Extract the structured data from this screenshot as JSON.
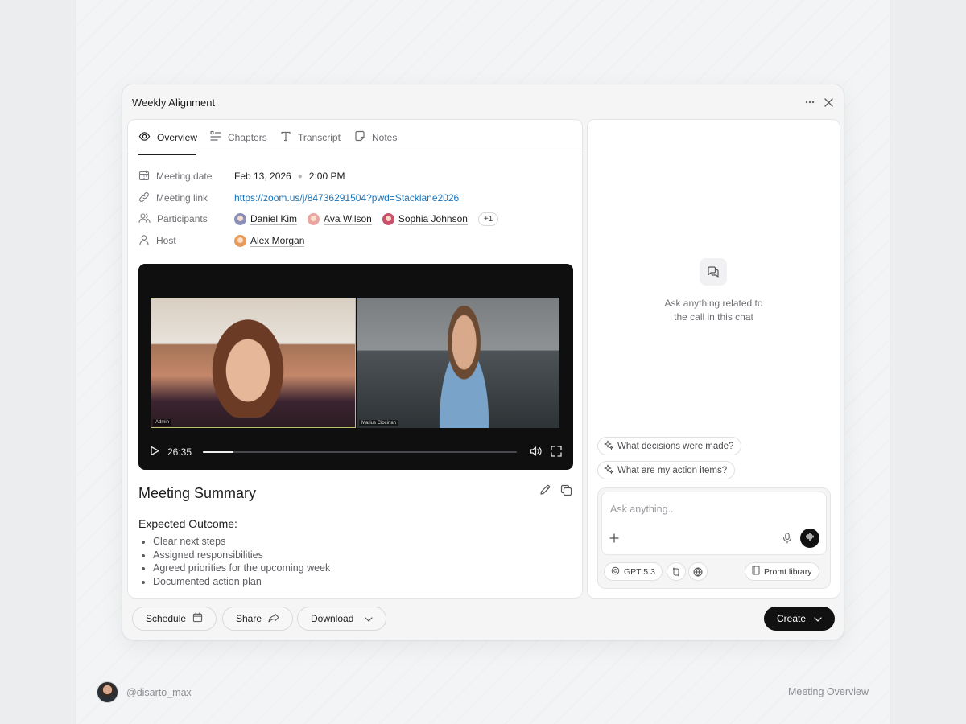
{
  "modal": {
    "title": "Weekly Alignment"
  },
  "tabs": [
    {
      "label": "Overview",
      "icon": "eye-icon",
      "active": true
    },
    {
      "label": "Chapters",
      "icon": "list-icon",
      "active": false
    },
    {
      "label": "Transcript",
      "icon": "text-icon",
      "active": false
    },
    {
      "label": "Notes",
      "icon": "note-icon",
      "active": false
    }
  ],
  "meta": {
    "date_label": "Meeting date",
    "date": "Feb 13, 2026",
    "time": "2:00 PM",
    "link_label": "Meeting link",
    "link": "https://zoom.us/j/84736291504?pwd=Stacklane2026",
    "participants_label": "Participants",
    "participants": [
      {
        "name": "Daniel Kim",
        "color": "#8a8fb8"
      },
      {
        "name": "Ava Wilson",
        "color": "#e9a6a0"
      },
      {
        "name": "Sophia Johnson",
        "color": "#c9506a"
      }
    ],
    "participants_more": "+1",
    "host_label": "Host",
    "host": {
      "name": "Alex Morgan",
      "color": "#e79a5a"
    }
  },
  "video": {
    "tiles": [
      {
        "label": "Admin"
      },
      {
        "label": "Marius Ciocirlan"
      }
    ],
    "time": "26:35",
    "progress": 0.097
  },
  "summary": {
    "title": "Meeting Summary",
    "section_title": "Expected Outcome:",
    "items": [
      "Clear next steps",
      "Assigned responsibilities",
      "Agreed priorities for the upcoming week",
      "Documented action plan"
    ]
  },
  "chat": {
    "empty_line1": "Ask anything related to",
    "empty_line2": "the call in this chat",
    "suggestions": [
      "What decisions were made?",
      "What are my action items?"
    ],
    "placeholder": "Ask anything...",
    "model": "GPT 5.3",
    "prompt_library": "Promt library"
  },
  "footer": {
    "schedule": "Schedule",
    "share": "Share",
    "download": "Download",
    "create": "Create"
  },
  "page": {
    "author": "@disarto_max",
    "label": "Meeting Overview"
  },
  "colors": {
    "accent": "#111111",
    "link": "#1a73b8"
  }
}
